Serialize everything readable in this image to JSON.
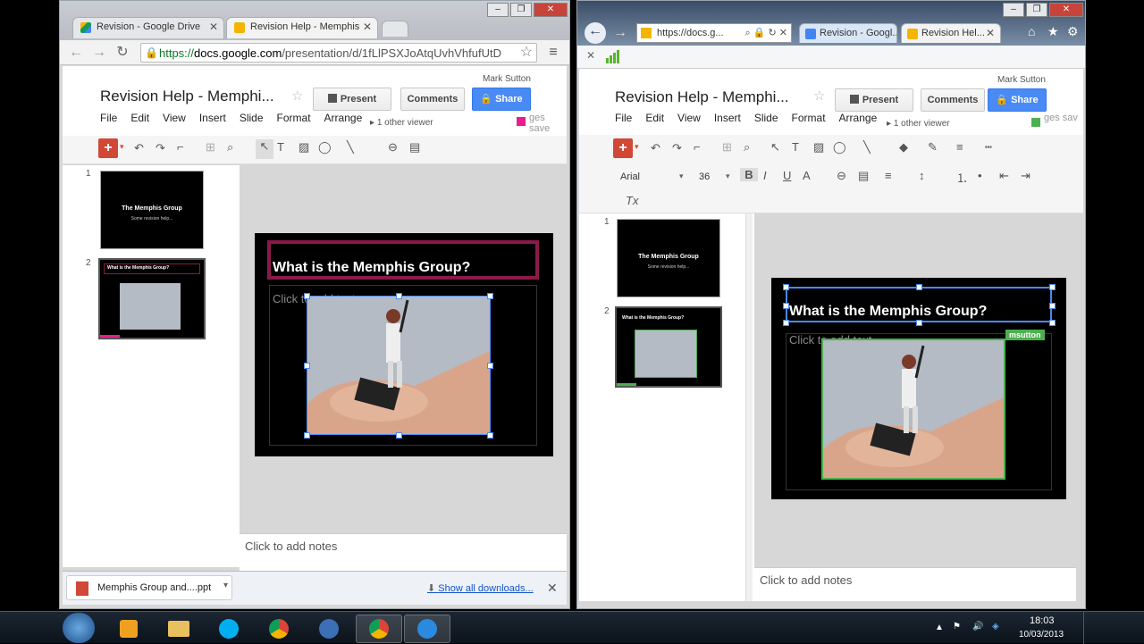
{
  "left_window": {
    "tabs": [
      {
        "label": "Revision - Google Drive",
        "icon": "google-drive-icon"
      },
      {
        "label": "Revision Help - Memphis",
        "icon": "google-slides-icon"
      }
    ],
    "url": {
      "secure": "https://",
      "host": "docs.google.com",
      "path": "/presentation/d/1fLlPSXJoAtqUvhVhfufUtD"
    },
    "user": "Mark Sutton",
    "doc_title": "Revision Help - Memphi...",
    "menu": [
      "File",
      "Edit",
      "View",
      "Insert",
      "Slide",
      "Format",
      "Arrange"
    ],
    "menu_tail": "ges save",
    "viewers": "1 other viewer",
    "present_label": "Present",
    "comments_label": "Comments",
    "share_label": "Share",
    "slides": [
      {
        "num": "1",
        "title": "The Memphis Group",
        "subtitle": "Some revision help..."
      },
      {
        "num": "2",
        "title": "What is the Memphis Group?"
      }
    ],
    "slide_title": "What is the Memphis Group?",
    "body_placeholder": "Click to add text",
    "notes": "Click to add notes",
    "download_file": "Memphis Group and....ppt",
    "show_downloads": "Show all downloads..."
  },
  "right_window": {
    "url_short": "https://docs.g...",
    "tabs": [
      {
        "label": "Revision - Googl..."
      },
      {
        "label": "Revision Hel..."
      }
    ],
    "user": "Mark Sutton",
    "doc_title": "Revision Help - Memphi...",
    "menu": [
      "File",
      "Edit",
      "View",
      "Insert",
      "Slide",
      "Format",
      "Arrange"
    ],
    "menu_tail": "ges sav",
    "viewers": "1 other viewer",
    "present_label": "Present",
    "comments_label": "Comments",
    "share_label": "Share",
    "font_name": "Arial",
    "font_size": "36",
    "slides": [
      {
        "num": "1",
        "title": "The Memphis Group",
        "subtitle": "Some revision help..."
      },
      {
        "num": "2",
        "title": "What is the Memphis Group?"
      }
    ],
    "slide_title": "What is the Memphis Group?",
    "body_placeholder": "Click to add text",
    "collaborator_tag": "msutton",
    "notes": "Click to add notes"
  },
  "taskbar": {
    "time": "18:03",
    "date": "10/03/2013"
  },
  "colors": {
    "docs_red": "#d14836",
    "share_blue": "#4a8af4",
    "collab_green": "#4caf50",
    "collab_pink": "#e91e8c",
    "title_box": "#8a1a4a"
  }
}
